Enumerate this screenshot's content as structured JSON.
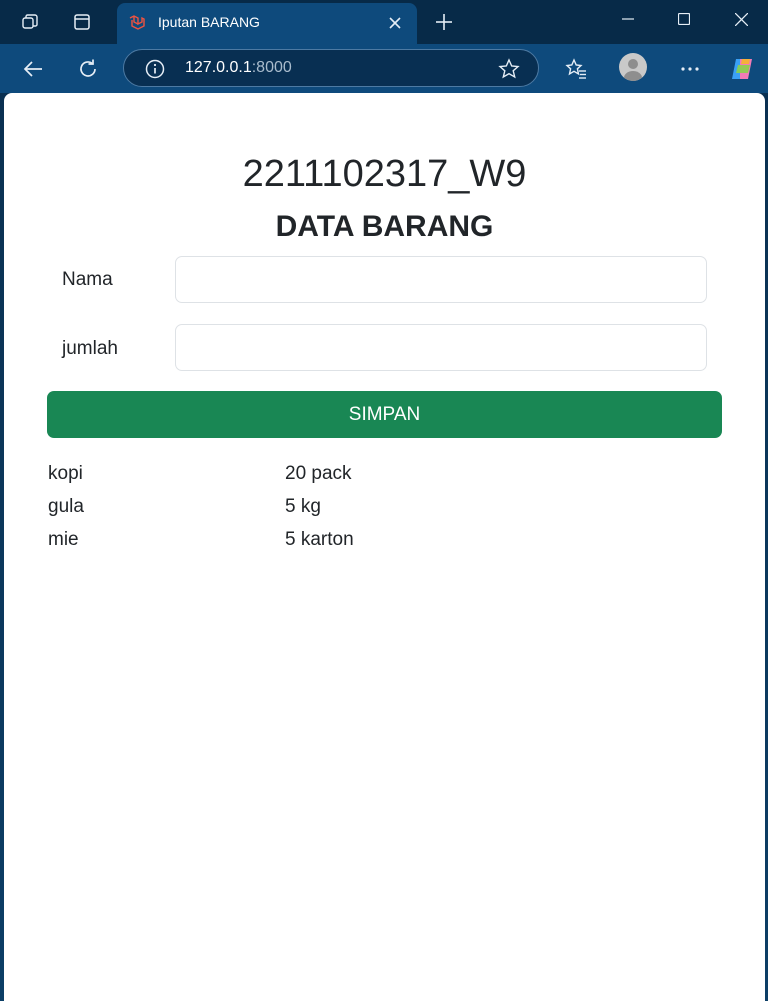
{
  "browser": {
    "tab_title": "Iputan BARANG",
    "address_host": "127.0.0.1",
    "address_port": ":8000"
  },
  "page": {
    "title": "2211102317_W9",
    "subtitle": "DATA BARANG",
    "form": {
      "nama_label": "Nama",
      "nama_value": "",
      "jumlah_label": "jumlah",
      "jumlah_value": "",
      "submit_label": "SIMPAN"
    },
    "items": [
      {
        "nama": "kopi",
        "jumlah": "20 pack"
      },
      {
        "nama": "gula",
        "jumlah": "5 kg"
      },
      {
        "nama": "mie",
        "jumlah": "5 karton"
      }
    ]
  },
  "colors": {
    "primary_button": "#198754",
    "browser_frame": "#0e4a7c",
    "favicon": "#f05340"
  }
}
